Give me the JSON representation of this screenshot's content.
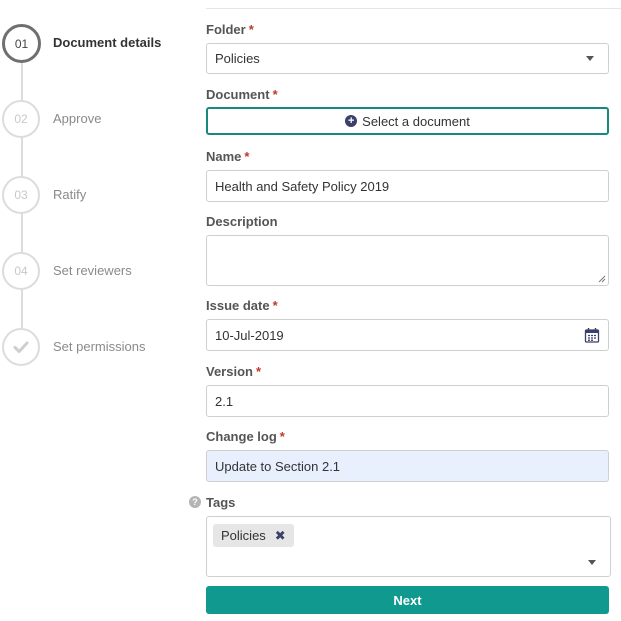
{
  "stepper": {
    "steps": [
      {
        "number": "01",
        "label": "Document details",
        "state": "active"
      },
      {
        "number": "02",
        "label": "Approve",
        "state": "pending"
      },
      {
        "number": "03",
        "label": "Ratify",
        "state": "pending"
      },
      {
        "number": "04",
        "label": "Set reviewers",
        "state": "pending"
      },
      {
        "number": "",
        "label": "Set permissions",
        "state": "pending",
        "icon": "check-icon"
      }
    ]
  },
  "form": {
    "required_marker": "*",
    "folder": {
      "label": "Folder",
      "value": "Policies",
      "icon": "chevron-down-icon"
    },
    "document": {
      "label": "Document",
      "button_label": "Select a document",
      "icon": "plus-circle-icon"
    },
    "name": {
      "label": "Name",
      "value": "Health and Safety Policy 2019"
    },
    "description": {
      "label": "Description",
      "value": ""
    },
    "issue_date": {
      "label": "Issue date",
      "value": "10-Jul-2019",
      "icon": "calendar-icon"
    },
    "version": {
      "label": "Version",
      "value": "2.1"
    },
    "change_log": {
      "label": "Change log",
      "value": "Update to Section 2.1"
    },
    "tags": {
      "label": "Tags",
      "help_icon": "?",
      "chips": [
        "Policies"
      ],
      "remove_icon": "✖"
    },
    "next_label": "Next"
  },
  "colors": {
    "accent": "#109a8f",
    "required": "#c0392b",
    "icon_dark": "#3b3f6b",
    "autofill_bg": "#e8f0fe"
  }
}
